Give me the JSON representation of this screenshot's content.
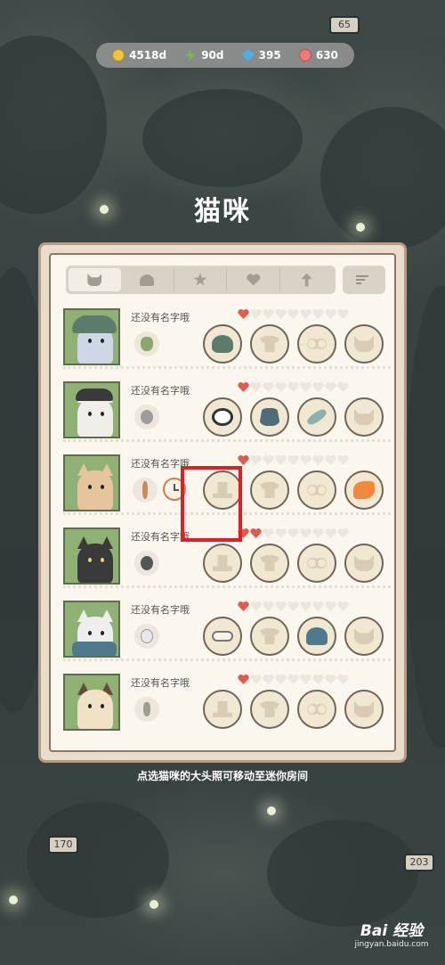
{
  "currencies": [
    {
      "icon": "coin-icon",
      "value": "4518d",
      "color": "#f2c43b"
    },
    {
      "icon": "energy-icon",
      "value": "90d",
      "color": "#6cc04a"
    },
    {
      "icon": "gem-icon",
      "value": "395",
      "color": "#4bb0e6"
    },
    {
      "icon": "fish-icon",
      "value": "630",
      "color": "#f07a7a"
    }
  ],
  "title": "猫咪",
  "tabs": [
    {
      "icon": "cat-icon",
      "active": true
    },
    {
      "icon": "chef-hat-icon",
      "active": false
    },
    {
      "icon": "star-icon",
      "active": false
    },
    {
      "icon": "heart-icon",
      "active": false
    },
    {
      "icon": "arrow-up-icon",
      "active": false
    }
  ],
  "sort_icon": "sort-icon",
  "cats": [
    {
      "name": "还没有名字哦",
      "hearts_filled": 1,
      "hearts_total": 9,
      "fav_food": "herb-icon",
      "slots": [
        "hat:green-cap",
        "shirt",
        "glasses",
        "face"
      ]
    },
    {
      "name": "还没有名字哦",
      "hearts_filled": 1,
      "hearts_total": 9,
      "fav_food": "grapes-icon",
      "slots": [
        "hat:panda-mask",
        "shirt:overalls",
        "glasses:fish-skewer",
        "face"
      ]
    },
    {
      "name": "还没有名字哦",
      "hearts_filled": 1,
      "hearts_total": 9,
      "fav_food": "skewer-icon",
      "clock": true,
      "slots": [
        "hat",
        "shirt",
        "glasses",
        "face:fried-shrimp"
      ]
    },
    {
      "name": "还没有名字哦",
      "hearts_filled": 2,
      "hearts_total": 9,
      "fav_food": "fish-bag-icon",
      "slots": [
        "hat",
        "shirt",
        "glasses",
        "face"
      ]
    },
    {
      "name": "还没有名字哦",
      "hearts_filled": 1,
      "hearts_total": 9,
      "fav_food": "garlic-icon",
      "slots": [
        "hat:bone",
        "shirt",
        "glasses:green-cap",
        "face"
      ]
    },
    {
      "name": "还没有名字哦",
      "hearts_filled": 1,
      "hearts_total": 9,
      "fav_food": "wheat-icon",
      "slots": [
        "hat",
        "shirt",
        "glasses",
        "face"
      ]
    }
  ],
  "hint": "点选猫咪的大头照可移动至迷你房间",
  "watermark": {
    "logo": "Bai 经验",
    "url": "jingyan.baidu.com"
  },
  "background_signs": [
    "170",
    "203",
    "65"
  ],
  "highlight_color": "#e41e1e"
}
